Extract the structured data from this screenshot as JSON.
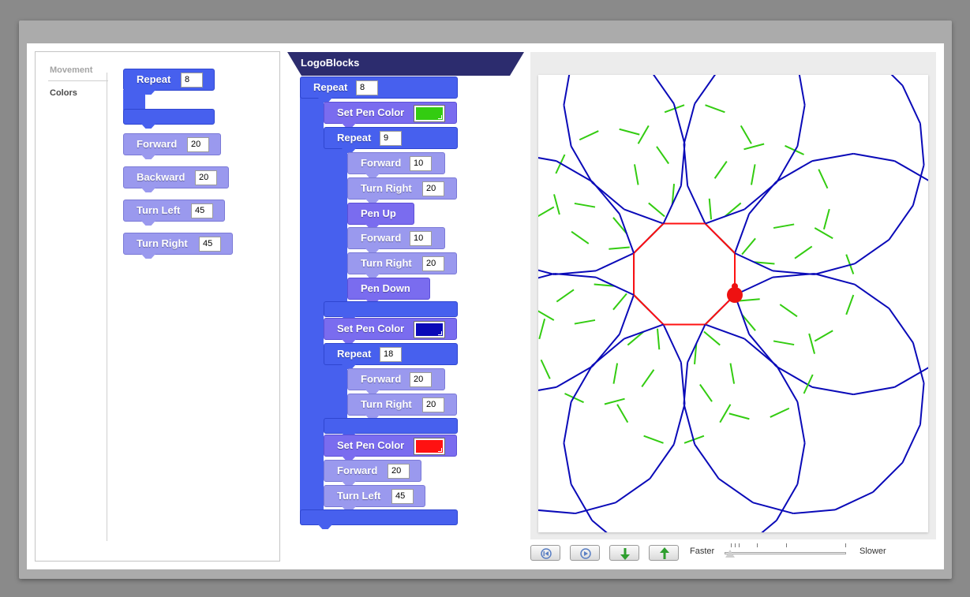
{
  "palette": {
    "categories": [
      "Movement",
      "Colors"
    ],
    "blocks": {
      "repeat": {
        "label": "Repeat",
        "value": "8"
      },
      "forward": {
        "label": "Forward",
        "value": "20"
      },
      "backward": {
        "label": "Backward",
        "value": "20"
      },
      "turn_left": {
        "label": "Turn Left",
        "value": "45"
      },
      "turn_right": {
        "label": "Turn Right",
        "value": "45"
      }
    }
  },
  "program": {
    "title": "LogoBlocks",
    "repeat_outer": {
      "label": "Repeat",
      "value": "8"
    },
    "set_pen_1": {
      "label": "Set Pen Color",
      "color": "#33cc11"
    },
    "repeat_1": {
      "label": "Repeat",
      "value": "9"
    },
    "fwd_1": {
      "label": "Forward",
      "value": "10"
    },
    "tr_1": {
      "label": "Turn Right",
      "value": "20"
    },
    "pen_up": {
      "label": "Pen Up"
    },
    "fwd_2": {
      "label": "Forward",
      "value": "10"
    },
    "tr_2": {
      "label": "Turn Right",
      "value": "20"
    },
    "pen_down": {
      "label": "Pen Down"
    },
    "set_pen_2": {
      "label": "Set Pen Color",
      "color": "#0a0ab8"
    },
    "repeat_2": {
      "label": "Repeat",
      "value": "18"
    },
    "fwd_3": {
      "label": "Forward",
      "value": "20"
    },
    "tr_3": {
      "label": "Turn Right",
      "value": "20"
    },
    "set_pen_3": {
      "label": "Set Pen Color",
      "color": "#ff1111"
    },
    "fwd_4": {
      "label": "Forward",
      "value": "20"
    },
    "tl_1": {
      "label": "Turn Left",
      "value": "45"
    }
  },
  "controls": {
    "faster": "Faster",
    "slower": "Slower",
    "speed_level": 0.02
  },
  "colors": {
    "green_pen": "#33cc11",
    "blue_pen": "#0a0ab8",
    "red_pen": "#ff1111",
    "turtle": "#ee1111"
  }
}
